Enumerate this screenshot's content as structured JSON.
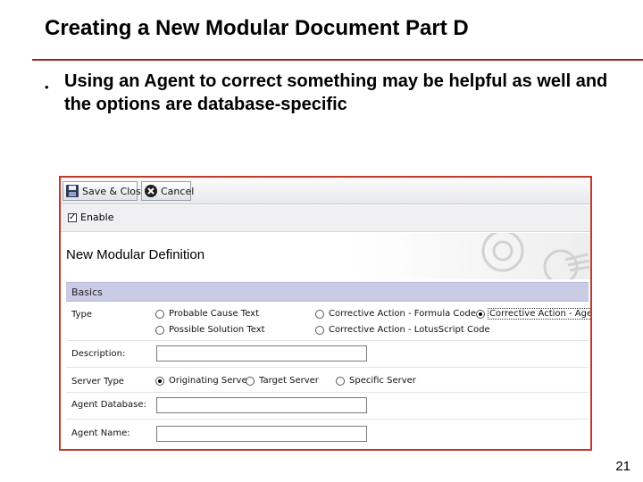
{
  "slide": {
    "title": "Creating a New Modular Document Part D",
    "bullet": "Using an Agent to correct something may be helpful as well and the options are database-specific",
    "page_number": "21",
    "accent_color": "#a02323"
  },
  "window": {
    "toolbar": {
      "save_close": "Save & Close",
      "cancel": "Cancel"
    },
    "enable": {
      "label": "Enable",
      "checked": true
    },
    "form_title": "New Modular Definition",
    "section": "Basics",
    "type": {
      "label": "Type",
      "options": [
        "Probable Cause Text",
        "Corrective Action - Formula Code",
        "Corrective Action - Agent",
        "Possible Solution Text",
        "Corrective Action - LotusScript Code"
      ],
      "selected": "Corrective Action - Agent"
    },
    "description": {
      "label": "Description:",
      "value": ""
    },
    "server_type": {
      "label": "Server Type",
      "options": [
        "Originating Server",
        "Target Server",
        "Specific Server"
      ],
      "selected": "Originating Server"
    },
    "agent_database": {
      "label": "Agent Database:",
      "value": ""
    },
    "agent_name": {
      "label": "Agent Name:",
      "value": ""
    },
    "section_color": "#c9cce5"
  }
}
